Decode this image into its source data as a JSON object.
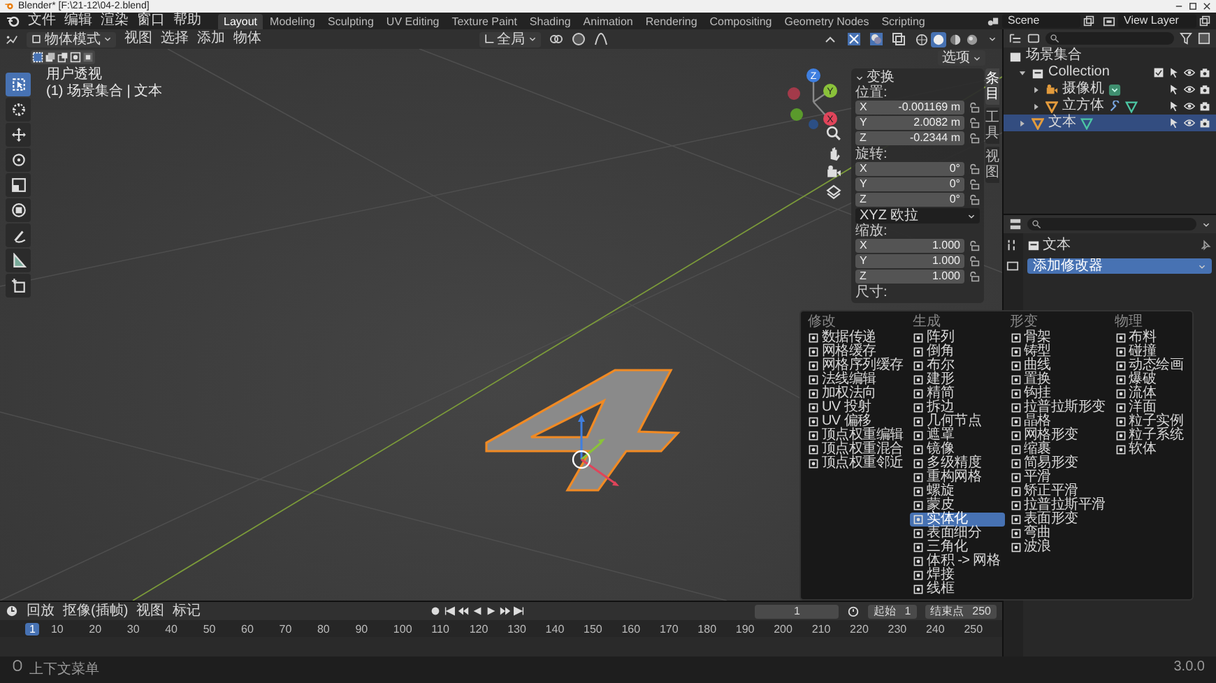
{
  "window": {
    "title": "Blender* [F:\\21-12\\04-2.blend]"
  },
  "menu": [
    "文件",
    "编辑",
    "渲染",
    "窗口",
    "帮助"
  ],
  "workspaces": [
    {
      "label": "Layout",
      "selected": true
    },
    {
      "label": "Modeling",
      "selected": false
    },
    {
      "label": "Sculpting",
      "selected": false
    },
    {
      "label": "UV Editing",
      "selected": false
    },
    {
      "label": "Texture Paint",
      "selected": false
    },
    {
      "label": "Shading",
      "selected": false
    },
    {
      "label": "Animation",
      "selected": false
    },
    {
      "label": "Rendering",
      "selected": false
    },
    {
      "label": "Compositing",
      "selected": false
    },
    {
      "label": "Geometry Nodes",
      "selected": false
    },
    {
      "label": "Scripting",
      "selected": false
    }
  ],
  "scene": "Scene",
  "view_layer": "View Layer",
  "viewport_header": {
    "mode": "物体模式",
    "menus": [
      "视图",
      "选择",
      "添加",
      "物体"
    ],
    "orientation": "全局",
    "options": "选项",
    "shading": [
      {
        "kind": "wireframe",
        "selected": false
      },
      {
        "kind": "solid",
        "selected": true
      },
      {
        "kind": "material",
        "selected": false
      },
      {
        "kind": "rendered",
        "selected": false
      }
    ]
  },
  "viewport": {
    "view_name": "用户透视",
    "context": "(1) 场景集合 | 文本",
    "gizmo_axes": [
      "X",
      "Y",
      "Z"
    ]
  },
  "tools": [
    {
      "kind": "select",
      "selected": true
    },
    {
      "kind": "cursor",
      "selected": false
    },
    {
      "kind": "move",
      "selected": false
    },
    {
      "kind": "rotate",
      "selected": false
    },
    {
      "kind": "scale",
      "selected": false
    },
    {
      "kind": "transform",
      "selected": false
    },
    {
      "kind": "annotate",
      "selected": false
    },
    {
      "kind": "measure",
      "selected": false
    },
    {
      "kind": "add-cube",
      "selected": false
    }
  ],
  "sidebar": {
    "tabs": [
      {
        "label": "条目",
        "selected": true
      },
      {
        "label": "工具",
        "selected": false
      },
      {
        "label": "视图",
        "selected": false
      }
    ],
    "panel_title": "变换",
    "location_label": "位置:",
    "location": [
      {
        "axis": "X",
        "value": "-0.001169 m"
      },
      {
        "axis": "Y",
        "value": "2.0082 m"
      },
      {
        "axis": "Z",
        "value": "-0.2344 m"
      }
    ],
    "rotation_label": "旋转:",
    "rotation": [
      {
        "axis": "X",
        "value": "0°"
      },
      {
        "axis": "Y",
        "value": "0°"
      },
      {
        "axis": "Z",
        "value": "0°"
      }
    ],
    "rotation_mode": "XYZ 欧拉",
    "scale_label": "缩放:",
    "scale": [
      {
        "axis": "X",
        "value": "1.000"
      },
      {
        "axis": "Y",
        "value": "1.000"
      },
      {
        "axis": "Z",
        "value": "1.000"
      }
    ],
    "dimensions_label": "尺寸:"
  },
  "outliner": {
    "root": "场景集合",
    "items": [
      {
        "name": "Collection",
        "kind": "collection",
        "expanded": true,
        "selected": false,
        "has_modifiers": false,
        "children": [
          {
            "name": "摄像机",
            "kind": "camera",
            "expanded": false,
            "selected": false,
            "has_modifiers": false
          },
          {
            "name": "立方体",
            "kind": "mesh",
            "expanded": false,
            "selected": false,
            "has_modifiers": true
          }
        ]
      },
      {
        "name": "文本",
        "kind": "mesh",
        "expanded": false,
        "selected": true,
        "has_modifiers": false
      }
    ]
  },
  "properties": {
    "object_name": "文本",
    "add_modifier": "添加修改器"
  },
  "modifier_menu": {
    "columns": [
      {
        "title": "修改",
        "items": [
          {
            "label": "数据传递",
            "selected": false
          },
          {
            "label": "网格缓存",
            "selected": false
          },
          {
            "label": "网格序列缓存",
            "selected": false
          },
          {
            "label": "法线编辑",
            "selected": false
          },
          {
            "label": "加权法向",
            "selected": false
          },
          {
            "label": "UV 投射",
            "selected": false
          },
          {
            "label": "UV 偏移",
            "selected": false
          },
          {
            "label": "顶点权重编辑",
            "selected": false
          },
          {
            "label": "顶点权重混合",
            "selected": false
          },
          {
            "label": "顶点权重邻近",
            "selected": false
          }
        ]
      },
      {
        "title": "生成",
        "items": [
          {
            "label": "阵列",
            "selected": false
          },
          {
            "label": "倒角",
            "selected": false
          },
          {
            "label": "布尔",
            "selected": false
          },
          {
            "label": "建形",
            "selected": false
          },
          {
            "label": "精简",
            "selected": false
          },
          {
            "label": "拆边",
            "selected": false
          },
          {
            "label": "几何节点",
            "selected": false
          },
          {
            "label": "遮罩",
            "selected": false
          },
          {
            "label": "镜像",
            "selected": false
          },
          {
            "label": "多级精度",
            "selected": false
          },
          {
            "label": "重构网格",
            "selected": false
          },
          {
            "label": "螺旋",
            "selected": false
          },
          {
            "label": "蒙皮",
            "selected": false
          },
          {
            "label": "实体化",
            "selected": true
          },
          {
            "label": "表面细分",
            "selected": false
          },
          {
            "label": "三角化",
            "selected": false
          },
          {
            "label": "体积 -> 网格",
            "selected": false
          },
          {
            "label": "焊接",
            "selected": false
          },
          {
            "label": "线框",
            "selected": false
          }
        ]
      },
      {
        "title": "形变",
        "items": [
          {
            "label": "骨架",
            "selected": false
          },
          {
            "label": "铸型",
            "selected": false
          },
          {
            "label": "曲线",
            "selected": false
          },
          {
            "label": "置换",
            "selected": false
          },
          {
            "label": "钩挂",
            "selected": false
          },
          {
            "label": "拉普拉斯形变",
            "selected": false
          },
          {
            "label": "晶格",
            "selected": false
          },
          {
            "label": "网格形变",
            "selected": false
          },
          {
            "label": "缩裹",
            "selected": false
          },
          {
            "label": "简易形变",
            "selected": false
          },
          {
            "label": "平滑",
            "selected": false
          },
          {
            "label": "矫正平滑",
            "selected": false
          },
          {
            "label": "拉普拉斯平滑",
            "selected": false
          },
          {
            "label": "表面形变",
            "selected": false
          },
          {
            "label": "弯曲",
            "selected": false
          },
          {
            "label": "波浪",
            "selected": false
          }
        ]
      },
      {
        "title": "物理",
        "items": [
          {
            "label": "布料",
            "selected": false
          },
          {
            "label": "碰撞",
            "selected": false
          },
          {
            "label": "动态绘画",
            "selected": false
          },
          {
            "label": "爆破",
            "selected": false
          },
          {
            "label": "流体",
            "selected": false
          },
          {
            "label": "洋面",
            "selected": false
          },
          {
            "label": "粒子实例",
            "selected": false
          },
          {
            "label": "粒子系统",
            "selected": false
          },
          {
            "label": "软体",
            "selected": false
          }
        ]
      }
    ]
  },
  "timeline": {
    "menus": [
      "回放",
      "抠像(插帧)",
      "视图",
      "标记"
    ],
    "current_frame": "1",
    "frame_field": "1",
    "start_label": "起始",
    "start": "1",
    "end_label": "结束点",
    "end": "250",
    "ticks": [
      "10",
      "20",
      "30",
      "40",
      "50",
      "60",
      "70",
      "80",
      "90",
      "100",
      "110",
      "120",
      "130",
      "140",
      "150",
      "160",
      "170",
      "180",
      "190",
      "200",
      "210",
      "220",
      "230",
      "240",
      "250"
    ]
  },
  "status_bar": {
    "hint": "上下文菜单",
    "version": "3.0.0"
  }
}
